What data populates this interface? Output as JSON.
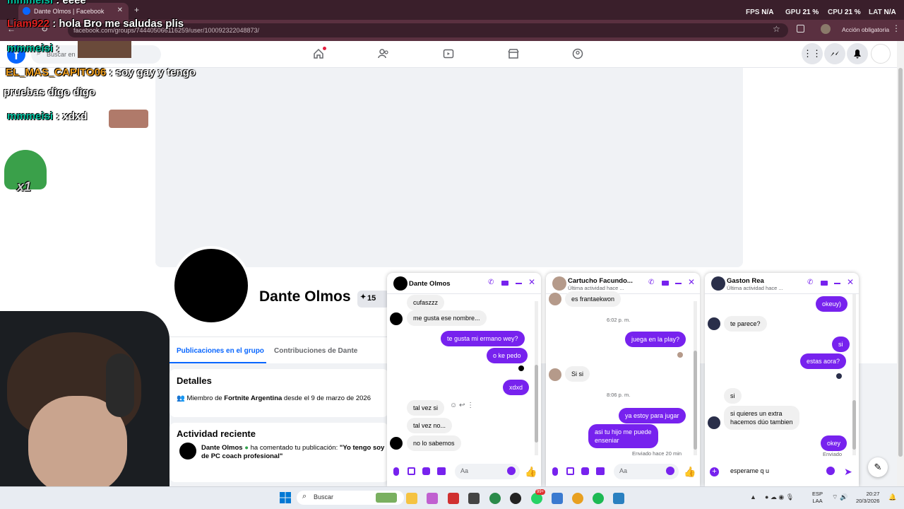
{
  "browser": {
    "tab_title": "Dante Olmos | Facebook",
    "url": "facebook.com/groups/744405066116259/user/100092322048873/",
    "action_label": "Acción obligatoria",
    "nav_new_dot": "#e41e3f"
  },
  "hud": {
    "fps_label": "FPS",
    "fps_value": "N/A",
    "gpu_label": "GPU",
    "gpu_value": "21 %",
    "cpu_label": "CPU",
    "cpu_value": "21 %",
    "lat_label": "LAT",
    "lat_value": "N/A"
  },
  "overlay": {
    "l1_user": "mmmeisi",
    "l1_text": ": eeee",
    "l2_user": "Liam922",
    "l2_text": ": hola Bro me saludas plis",
    "l3_user": "mmmeisi",
    "l3_text": ":",
    "l4_user": "EL_MAS_CAPITO06",
    "l4_text": ": soy gay y tengo",
    "l4b_text": "pruebas digo digo",
    "l5_user": "mmmeisi",
    "l5_text": ": xdxd",
    "sticker_text": "x1"
  },
  "fb": {
    "search_placeholder": "Buscar en",
    "profile_name": "Dante Olmos",
    "badge_count": "15",
    "tab_posts": "Publicaciones en el grupo",
    "tab_contrib": "Contribuciones de Dante",
    "details_title": "Detalles",
    "member_prefix": "Miembro de",
    "member_group": "Fortnite Argentina",
    "member_suffix": "desde el 9 de marzo de 2026",
    "activity_title": "Actividad reciente",
    "activity_user": "Dante Olmos",
    "activity_mid": "ha comentado tu publicación:",
    "activity_quote": "\"Yo tengo soy de PC coach profesional\""
  },
  "chat1": {
    "name": "Dante Olmos",
    "messages": [
      "cufaszzz",
      "me gusta ese nombre...",
      "te gusta mi ermano wey?",
      "o ke pedo",
      "xdxd",
      "tal vez si",
      "tal vez no...",
      "no lo sabemos"
    ],
    "input_placeholder": "Aa"
  },
  "chat2": {
    "name": "Cartucho Facundo...",
    "status": "Última actividad hace ...",
    "messages": [
      "es frantaekwon",
      "6:02 p. m.",
      "juega en la play?",
      "Si si",
      "8:06 p. m.",
      "ya estoy para jugar",
      "asi tu hijo me puede",
      "enseniar",
      "Enviado hace 20 min"
    ],
    "input_placeholder": "Aa"
  },
  "chat3": {
    "name": "Gaston Rea",
    "status": "Última actividad hace ...",
    "messages": [
      "okeuy)",
      "te parece?",
      "si",
      "estas aora?",
      "si",
      "si quieres un extra",
      "hacemos dúo tambien",
      "okey",
      "Enviado"
    ],
    "input_value": "esperame  q u"
  },
  "taskbar": {
    "search": "Buscar",
    "lang1": "ESP",
    "lang2": "LAA",
    "time": "20:27",
    "date": "20/3/2026",
    "badge": "99+"
  },
  "colors": {
    "accent": "#7722ee",
    "fb_blue": "#0866ff",
    "tab_bg": "#5a3040"
  }
}
